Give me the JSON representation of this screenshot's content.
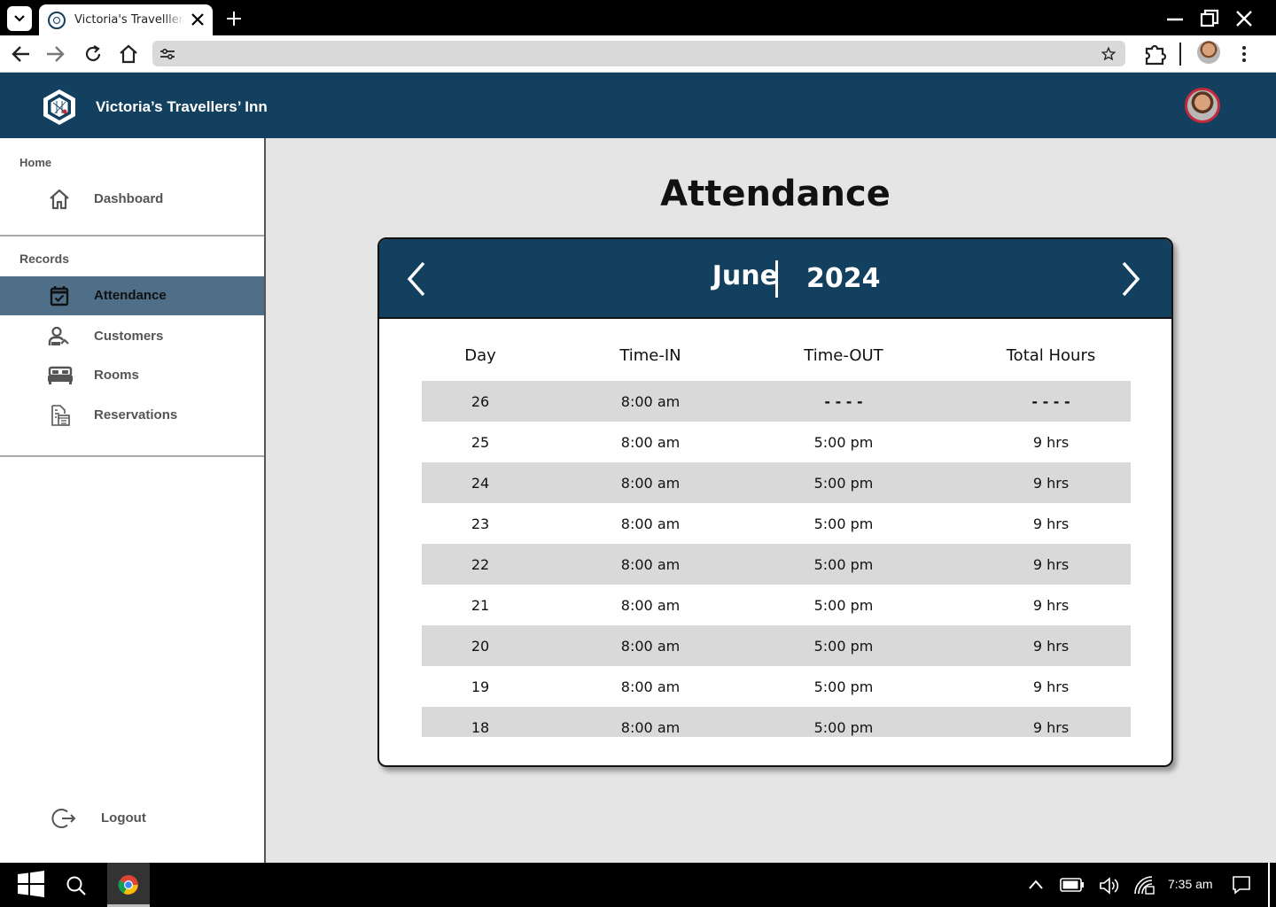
{
  "browser": {
    "tab_title": "Victoria's Travelller's",
    "address": ""
  },
  "app": {
    "title": "Victoria’s Travellers’ Inn"
  },
  "sidebar": {
    "home_section": "Home",
    "records_section": "Records",
    "items": [
      {
        "label": "Dashboard",
        "icon": "home-icon"
      },
      {
        "label": "Attendance",
        "icon": "calendar-check-icon",
        "active": true
      },
      {
        "label": "Customers",
        "icon": "customers-icon"
      },
      {
        "label": "Rooms",
        "icon": "bed-icon"
      },
      {
        "label": "Reservations",
        "icon": "reservations-icon"
      }
    ],
    "logout_label": "Logout"
  },
  "main": {
    "title": "Attendance",
    "month": "June",
    "year": "2024",
    "columns": [
      "Day",
      "Time-IN",
      "Time-OUT",
      "Total Hours"
    ],
    "rows": [
      [
        "26",
        "8:00 am",
        "- - - -",
        "- - - -"
      ],
      [
        "25",
        "8:00 am",
        "5:00 pm",
        "9 hrs"
      ],
      [
        "24",
        "8:00 am",
        "5:00 pm",
        "9 hrs"
      ],
      [
        "23",
        "8:00 am",
        "5:00 pm",
        "9 hrs"
      ],
      [
        "22",
        "8:00 am",
        "5:00 pm",
        "9 hrs"
      ],
      [
        "21",
        "8:00 am",
        "5:00 pm",
        "9 hrs"
      ],
      [
        "20",
        "8:00 am",
        "5:00 pm",
        "9 hrs"
      ],
      [
        "19",
        "8:00 am",
        "5:00 pm",
        "9 hrs"
      ],
      [
        "18",
        "8:00 am",
        "5:00 pm",
        "9 hrs"
      ]
    ]
  },
  "taskbar": {
    "time": "7:35 am"
  },
  "colors": {
    "header": "#12405e",
    "active_nav": "#4f6f88",
    "row_shade": "#d9d9d9"
  }
}
